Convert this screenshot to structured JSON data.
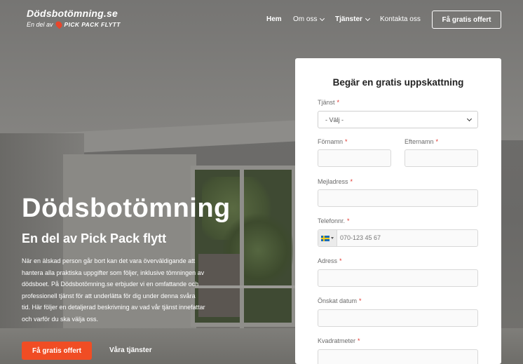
{
  "header": {
    "logo_title": "Dödsbotömning.se",
    "logo_sub_prefix": "En del av",
    "logo_brand": "PICK PACK FLYTT",
    "nav": [
      {
        "label": "Hem"
      },
      {
        "label": "Om oss"
      },
      {
        "label": "Tjänster"
      },
      {
        "label": "Kontakta oss"
      }
    ],
    "cta_label": "Få gratis offert"
  },
  "hero": {
    "title": "Dödsbotömning",
    "subtitle": "En del av Pick Pack flytt",
    "description": "När en älskad person går bort kan det vara överväldigande att hantera alla praktiska uppgifter som följer, inklusive tömningen av dödsboet. På Dödsbotömning.se erbjuder vi en omfattande och professionell tjänst för att underlätta för dig under denna svåra tid. Här följer en detaljerad beskrivning av vad vår tjänst innefattar och varför du ska välja oss.",
    "primary_button": "Få gratis offert",
    "secondary_button": "Våra tjänster"
  },
  "form": {
    "title": "Begär en gratis uppskattning",
    "required_mark": "*",
    "service_label": "Tjänst",
    "service_value": "- Välj -",
    "firstname_label": "Förnamn",
    "lastname_label": "Efternamn",
    "email_label": "Mejladress",
    "phone_label": "Telefonnr.",
    "phone_placeholder": "070-123 45 67",
    "address_label": "Adress",
    "date_label": "Önskat datum",
    "sqm_label": "Kvadratmeter"
  },
  "colors": {
    "accent": "#f04d24",
    "required": "#e0332b"
  }
}
